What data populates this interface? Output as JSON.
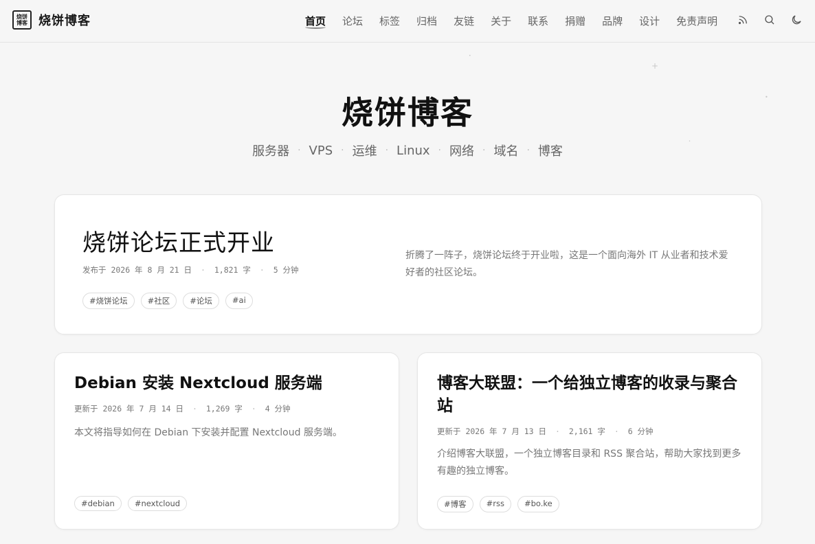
{
  "brand": {
    "logo_lines": [
      "烧饼",
      "博客"
    ],
    "name": "烧饼博客"
  },
  "nav": {
    "items": [
      "首页",
      "论坛",
      "标签",
      "归档",
      "友链",
      "关于",
      "联系",
      "捐赠",
      "品牌",
      "设计",
      "免责声明"
    ],
    "active_index": 0,
    "icons": [
      "rss-icon",
      "search-icon",
      "moon-icon"
    ]
  },
  "hero": {
    "title": "烧饼博客",
    "subtitle_items": [
      "服务器",
      "VPS",
      "运维",
      "Linux",
      "网络",
      "域名",
      "博客"
    ],
    "separator": "·"
  },
  "posts": [
    {
      "title": "烧饼论坛正式开业",
      "meta_prefix": "发布于",
      "date": "2026 年 8 月 21 日",
      "words": "1,821 字",
      "read_time": "5 分钟",
      "excerpt": "折腾了一阵子，烧饼论坛终于开业啦，这是一个面向海外 IT 从业者和技术爱好者的社区论坛。",
      "tags": [
        "#烧饼论坛",
        "#社区",
        "#论坛",
        "#ai"
      ]
    },
    {
      "title": "Debian 安装 Nextcloud 服务端",
      "meta_prefix": "更新于",
      "date": "2026 年 7 月 14 日",
      "words": "1,269 字",
      "read_time": "4 分钟",
      "excerpt": "本文将指导如何在 Debian 下安装并配置 Nextcloud 服务端。",
      "tags": [
        "#debian",
        "#nextcloud"
      ]
    },
    {
      "title": "博客大联盟：一个给独立博客的收录与聚合站",
      "meta_prefix": "更新于",
      "date": "2026 年 7 月 13 日",
      "words": "2,161 字",
      "read_time": "6 分钟",
      "excerpt": "介绍博客大联盟，一个独立博客目录和 RSS 聚合站，帮助大家找到更多有趣的独立博客。",
      "tags": [
        "#博客",
        "#rss",
        "#bo.ke"
      ]
    }
  ],
  "meta_separators": {
    "dot": "·"
  }
}
